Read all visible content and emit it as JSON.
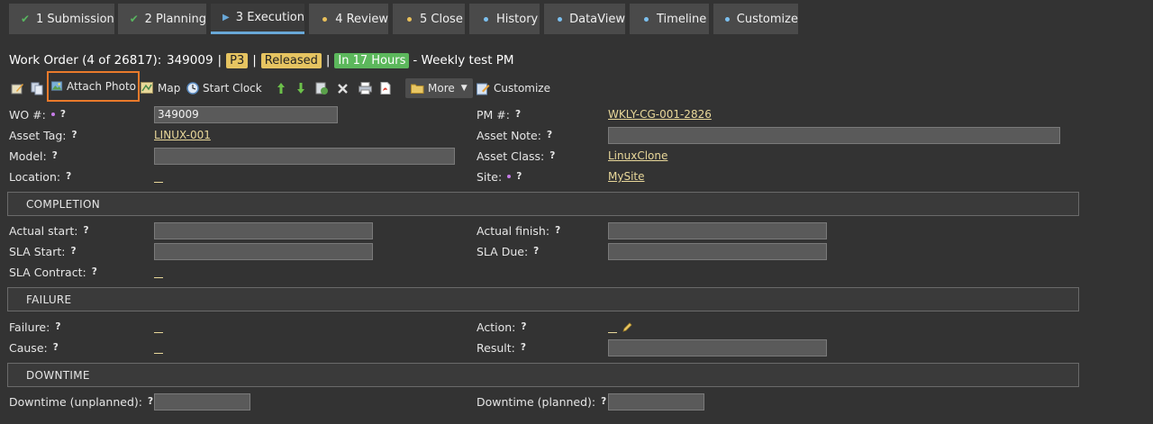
{
  "tabs": [
    {
      "label": "1 Submission",
      "icon": "check-icon"
    },
    {
      "label": "2 Planning",
      "icon": "check-icon"
    },
    {
      "label": "3 Execution",
      "icon": "play-icon",
      "active": true
    },
    {
      "label": "4 Review",
      "icon": "dot-yellow-icon"
    },
    {
      "label": "5 Close",
      "icon": "dot-yellow-icon"
    },
    {
      "label": "History",
      "icon": "dot-blue-icon"
    },
    {
      "label": "DataView",
      "icon": "dot-blue-icon"
    },
    {
      "label": "Timeline",
      "icon": "dot-blue-icon"
    },
    {
      "label": "Customize",
      "icon": "dot-blue-icon"
    }
  ],
  "header": {
    "wo_count": "Work Order (4 of 26817):",
    "wo_number": "349009",
    "sep": "|",
    "priority": "P3",
    "status": "Released",
    "due": "In 17 Hours",
    "title": "- Weekly test PM"
  },
  "toolbar": {
    "attach_photo": "Attach Photo",
    "map": "Map",
    "start_clock": "Start Clock",
    "more": "More",
    "customize": "Customize"
  },
  "fields": {
    "wo_num_label": "WO #:",
    "wo_num_value": "349009",
    "pm_num_label": "PM #:",
    "pm_num_value": "WKLY-CG-001-2826",
    "asset_tag_label": "Asset Tag:",
    "asset_tag_value": "LINUX-001",
    "asset_note_label": "Asset Note:",
    "model_label": "Model:",
    "asset_class_label": "Asset Class:",
    "asset_class_value": "LinuxClone",
    "location_label": "Location:",
    "site_label": "Site:",
    "site_value": "MySite",
    "q": "?"
  },
  "completion": {
    "title": "COMPLETION",
    "actual_start_label": "Actual start:",
    "actual_finish_label": "Actual finish:",
    "sla_start_label": "SLA Start:",
    "sla_due_label": "SLA Due:",
    "sla_contract_label": "SLA Contract:"
  },
  "failure": {
    "title": "FAILURE",
    "failure_label": "Failure:",
    "action_label": "Action:",
    "cause_label": "Cause:",
    "result_label": "Result:"
  },
  "downtime": {
    "title": "DOWNTIME",
    "unplanned_label": "Downtime (unplanned):",
    "planned_label": "Downtime (planned):"
  }
}
